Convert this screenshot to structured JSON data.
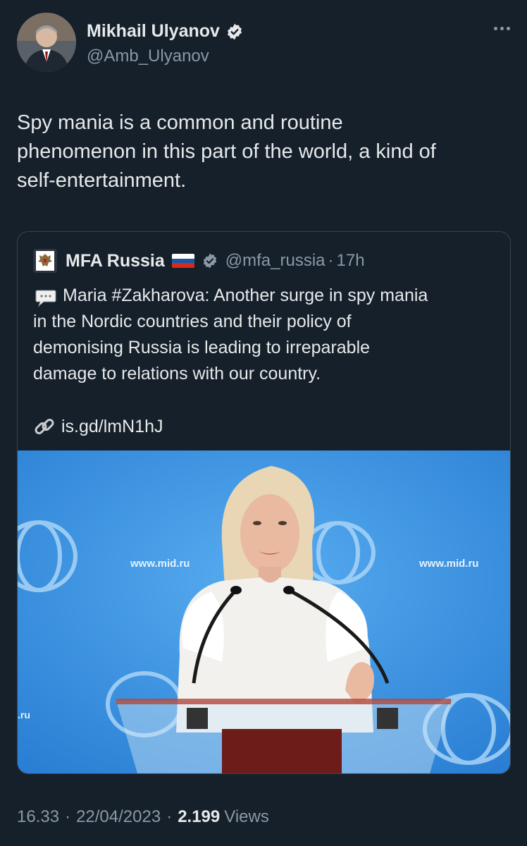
{
  "author": {
    "name": "Mikhail Ulyanov",
    "handle": "@Amb_Ulyanov",
    "avatar_icon": "profile-photo"
  },
  "tweet": {
    "text": "Spy mania is a common and routine\nphenomenon in this part of the world, a kind of\nself-entertainment."
  },
  "quote": {
    "name": "MFA Russia",
    "handle": "@mfa_russia",
    "separator": "·",
    "time": "17h",
    "text": "Maria #Zakharova: Another surge in spy mania\nin the Nordic countries and their policy of\ndemonising Russia is leading to irreparable\ndamage to relations with our country.",
    "link": "is.gd/lmN1hJ",
    "photo": {
      "backdrop_left": "www.mid.ru",
      "backdrop_right": "www.mid.ru",
      "edge_text": ".ru"
    }
  },
  "footer": {
    "time": "16.33",
    "sep1": "·",
    "date": "22/04/2023",
    "sep2": "·",
    "views_count": "2.199",
    "views_label": "Views"
  },
  "colors": {
    "background": "#15202b",
    "verified": "#e7e9ea",
    "muted": "#8b98a5",
    "photo_backdrop": "#2f8be0"
  }
}
